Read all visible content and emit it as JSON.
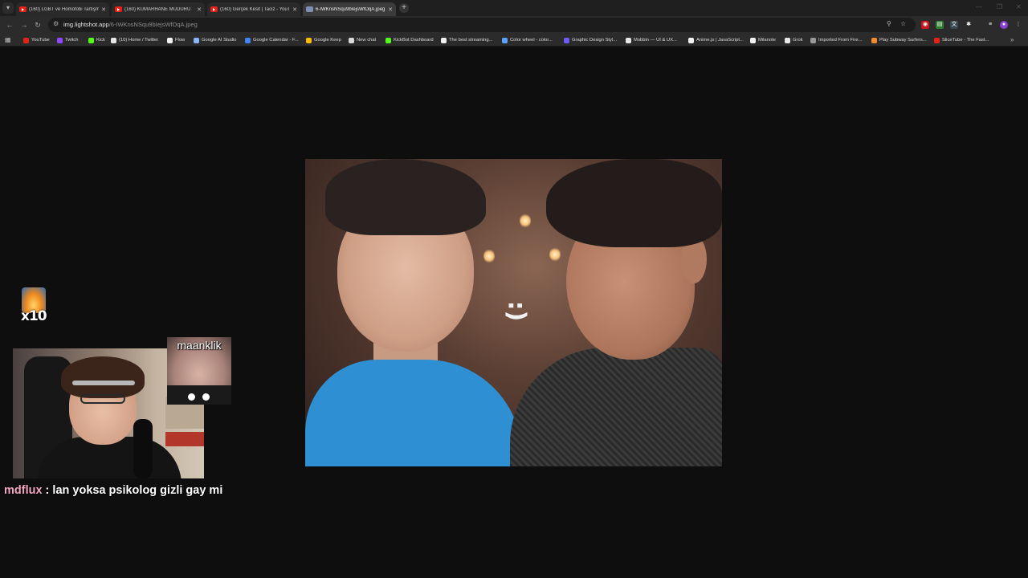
{
  "browser": {
    "tabs": [
      {
        "title": "(160) LGBT ve Homofobi Tartışması",
        "active": false,
        "favicon": "youtube-icon"
      },
      {
        "title": "(160) KUMARHANE MÜDÜRÜ",
        "active": false,
        "favicon": "youtube-icon"
      },
      {
        "title": "(160) Gerçek Kesit | Taciz - YouTube",
        "active": false,
        "favicon": "youtube-icon"
      },
      {
        "title": "6-IWKnsNSqu9bIejsWfOqA.jpeg",
        "active": true,
        "favicon": "image-icon"
      }
    ],
    "address": {
      "host": "img.lightshot.app",
      "path": "/6-IWKnsNSqu9bIejsWfOqA.jpeg"
    },
    "bookmarks": [
      {
        "label": "YouTube",
        "color": "#e62117"
      },
      {
        "label": "Twitch",
        "color": "#9146ff"
      },
      {
        "label": "Kick",
        "color": "#53fc18"
      },
      {
        "label": "(10) Home / Twitter",
        "color": "#e7e7e7"
      },
      {
        "label": "Flow",
        "color": "#f1f1f1"
      },
      {
        "label": "Google AI Studio",
        "color": "#8ab4f8"
      },
      {
        "label": "Google Calendar - F...",
        "color": "#4285f4"
      },
      {
        "label": "Google Keep",
        "color": "#fbbc04"
      },
      {
        "label": "New chat",
        "color": "#d9d9d9"
      },
      {
        "label": "KickBot Dashboard",
        "color": "#53fc18"
      },
      {
        "label": "The best streaming...",
        "color": "#f1f1f1"
      },
      {
        "label": "Color wheel - color...",
        "color": "#5aa3ff"
      },
      {
        "label": "Graphic Design Styl...",
        "color": "#6d5cf5"
      },
      {
        "label": "Mobbin — UI & UX...",
        "color": "#e7e7e7"
      },
      {
        "label": "Anime.js | JavaScript...",
        "color": "#f1f1f1"
      },
      {
        "label": "Milanote",
        "color": "#f1f1f1"
      },
      {
        "label": "Grok",
        "color": "#e7e7e7"
      },
      {
        "label": "Imported From Fire...",
        "color": "#9a9a9a"
      },
      {
        "label": "Play Subway Surfers...",
        "color": "#f28b2c"
      },
      {
        "label": "SliceTube - The Fast...",
        "color": "#e62117"
      }
    ]
  },
  "overlay": {
    "multiplier": "x10",
    "alert_username": "maanklik",
    "chat": {
      "username": "mdflux",
      "separator": " : ",
      "message": "lan yoksa psikolog gizli gay mi"
    },
    "photo_caption": ":)"
  }
}
